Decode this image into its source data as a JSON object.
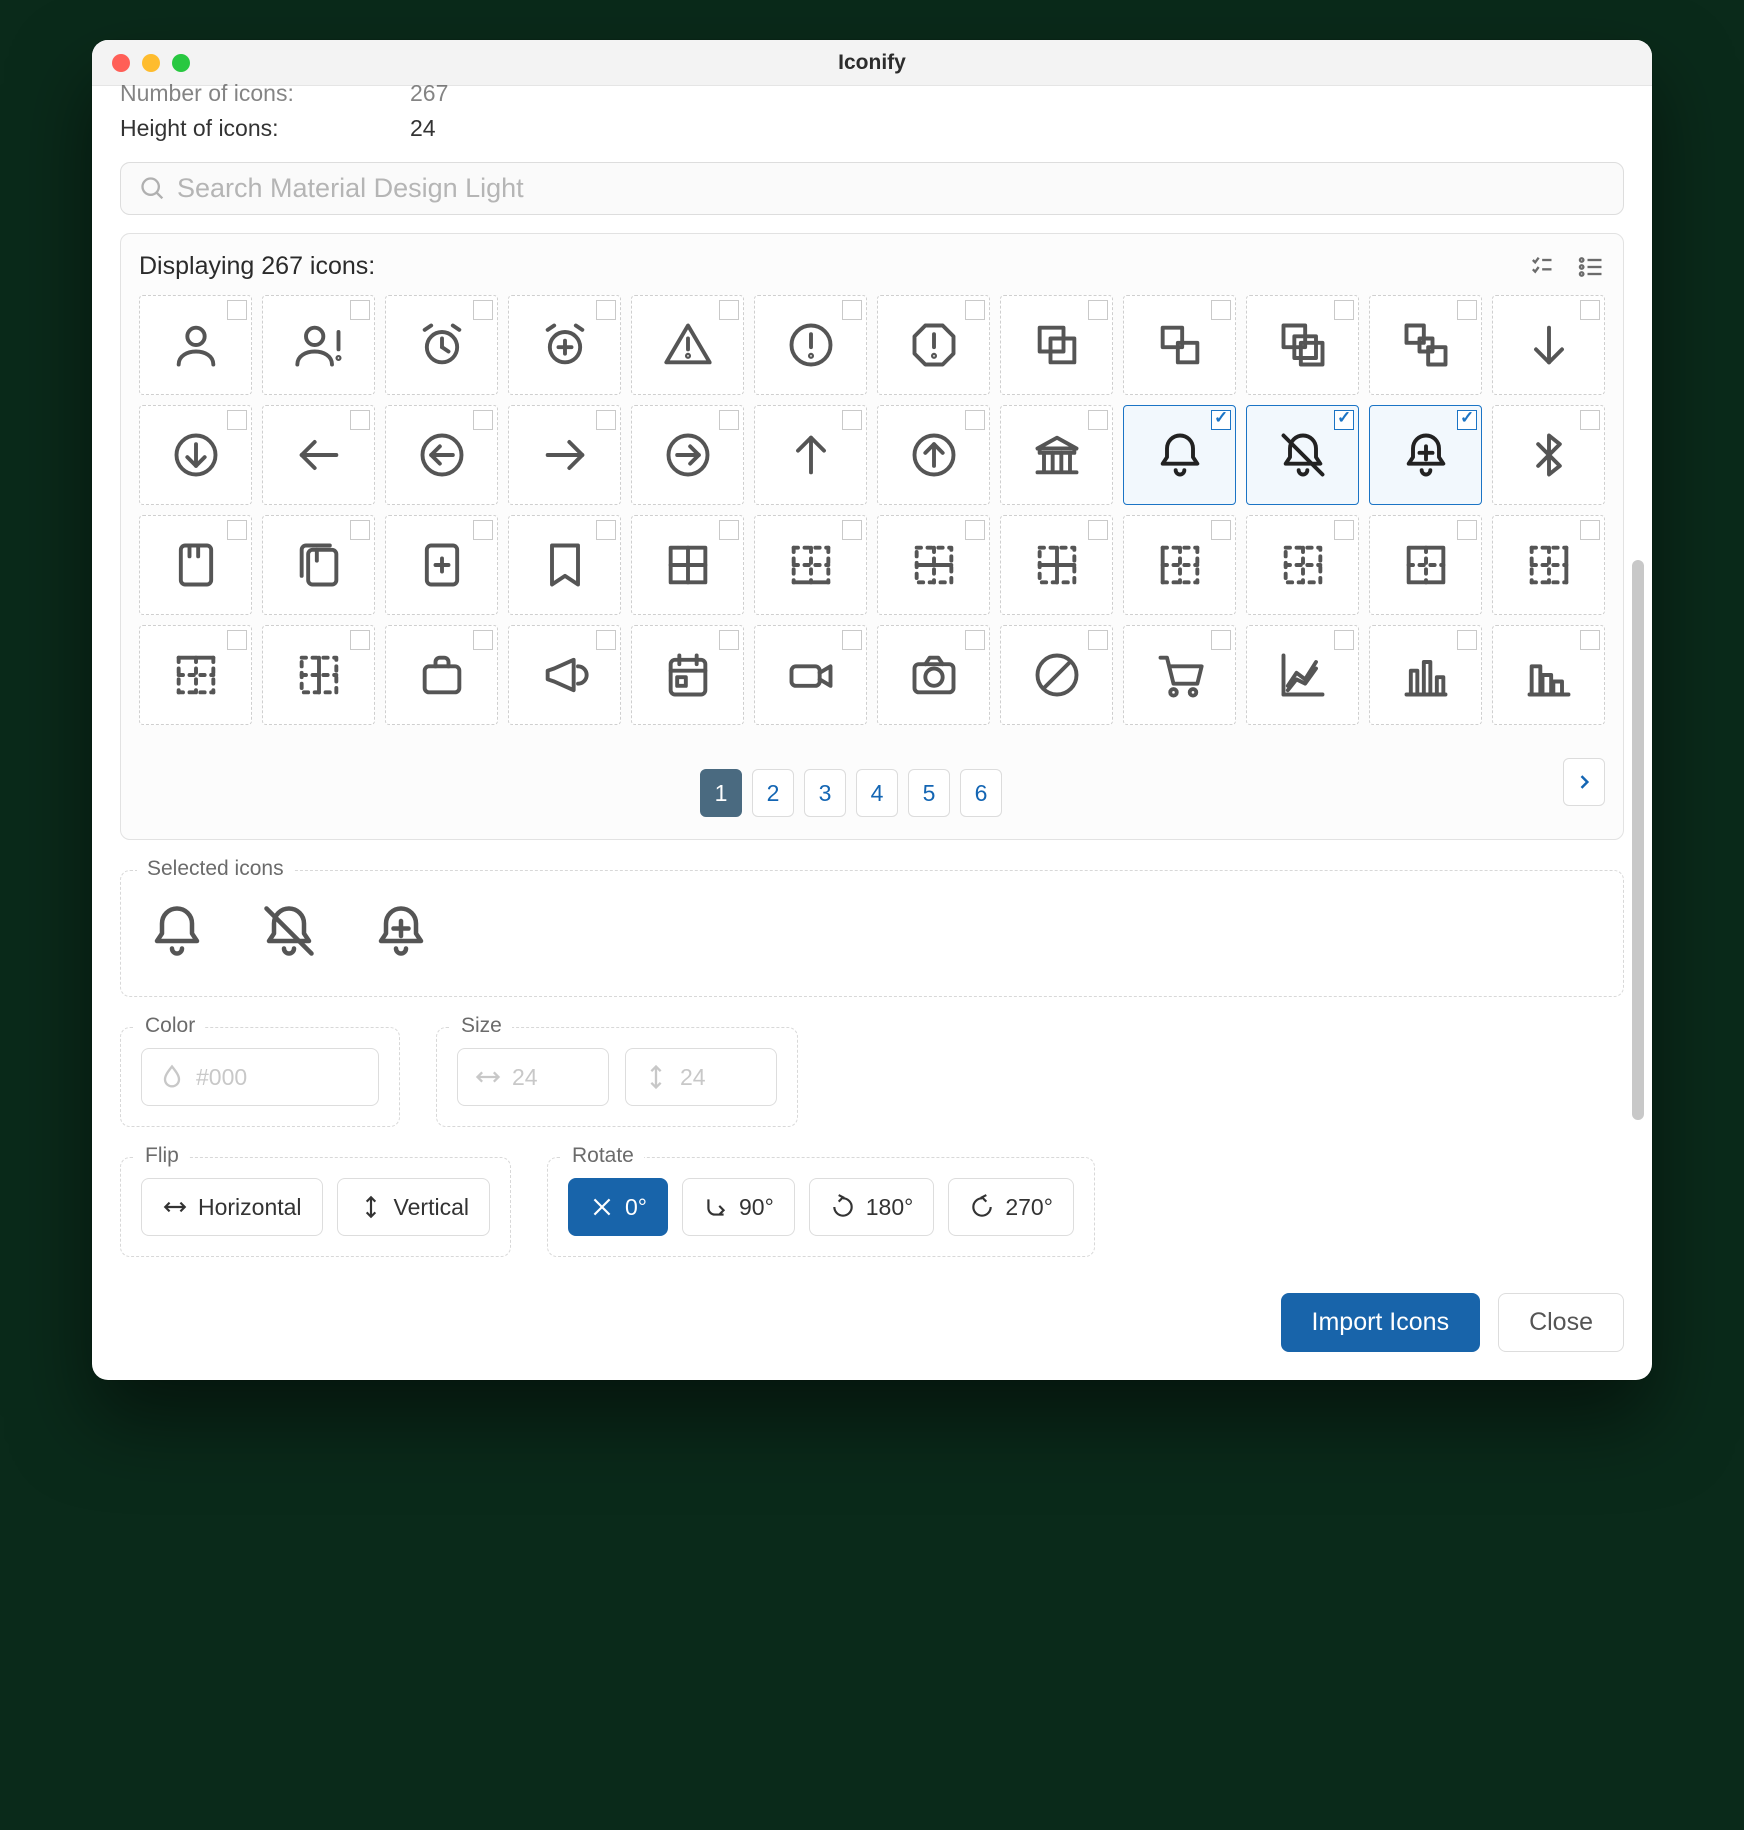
{
  "window_title": "Iconify",
  "meta": {
    "num_label": "Number of icons:",
    "num_value": "267",
    "height_label": "Height of icons:",
    "height_value": "24"
  },
  "search": {
    "placeholder": "Search Material Design Light"
  },
  "displaying": "Displaying 267 icons:",
  "pages": [
    "1",
    "2",
    "3",
    "4",
    "5",
    "6"
  ],
  "active_page": "1",
  "selected_label": "Selected icons",
  "color": {
    "label": "Color",
    "placeholder": "#000"
  },
  "size": {
    "label": "Size",
    "w_placeholder": "24",
    "h_placeholder": "24"
  },
  "flip": {
    "label": "Flip",
    "horizontal": "Horizontal",
    "vertical": "Vertical"
  },
  "rotate": {
    "label": "Rotate",
    "r0": "0°",
    "r90": "90°",
    "r180": "180°",
    "r270": "270°"
  },
  "footer": {
    "import": "Import Icons",
    "close": "Close"
  },
  "icons": [
    {
      "name": "account",
      "sel": false
    },
    {
      "name": "account-alert",
      "sel": false
    },
    {
      "name": "alarm",
      "sel": false
    },
    {
      "name": "alarm-plus",
      "sel": false
    },
    {
      "name": "alert-triangle",
      "sel": false
    },
    {
      "name": "alert-circle",
      "sel": false
    },
    {
      "name": "alert-octagon",
      "sel": false
    },
    {
      "name": "arrange-bring-forward",
      "sel": false
    },
    {
      "name": "arrange-send-backward",
      "sel": false
    },
    {
      "name": "arrange-bring-to-front",
      "sel": false
    },
    {
      "name": "arrange-send-to-back",
      "sel": false
    },
    {
      "name": "arrow-down",
      "sel": false
    },
    {
      "name": "arrow-down-circle",
      "sel": false
    },
    {
      "name": "arrow-left",
      "sel": false
    },
    {
      "name": "arrow-left-circle",
      "sel": false
    },
    {
      "name": "arrow-right",
      "sel": false
    },
    {
      "name": "arrow-right-circle",
      "sel": false
    },
    {
      "name": "arrow-up",
      "sel": false
    },
    {
      "name": "arrow-up-circle",
      "sel": false
    },
    {
      "name": "bank",
      "sel": false
    },
    {
      "name": "bell",
      "sel": true
    },
    {
      "name": "bell-off",
      "sel": true
    },
    {
      "name": "bell-plus",
      "sel": true
    },
    {
      "name": "bluetooth",
      "sel": false
    },
    {
      "name": "book",
      "sel": false
    },
    {
      "name": "book-multiple",
      "sel": false
    },
    {
      "name": "book-plus",
      "sel": false
    },
    {
      "name": "bookmark",
      "sel": false
    },
    {
      "name": "border-all",
      "sel": false
    },
    {
      "name": "border-bottom",
      "sel": false
    },
    {
      "name": "border-horizontal",
      "sel": false
    },
    {
      "name": "border-inside",
      "sel": false
    },
    {
      "name": "border-left",
      "sel": false
    },
    {
      "name": "border-none",
      "sel": false
    },
    {
      "name": "border-outside",
      "sel": false
    },
    {
      "name": "border-right",
      "sel": false
    },
    {
      "name": "border-top",
      "sel": false
    },
    {
      "name": "border-vertical",
      "sel": false
    },
    {
      "name": "briefcase",
      "sel": false
    },
    {
      "name": "bullhorn",
      "sel": false
    },
    {
      "name": "calendar",
      "sel": false
    },
    {
      "name": "camcorder",
      "sel": false
    },
    {
      "name": "camera",
      "sel": false
    },
    {
      "name": "cancel",
      "sel": false
    },
    {
      "name": "cart",
      "sel": false
    },
    {
      "name": "chart-areaspline",
      "sel": false
    },
    {
      "name": "chart-bar",
      "sel": false
    },
    {
      "name": "chart-histogram",
      "sel": false
    }
  ],
  "selected_icons": [
    "bell",
    "bell-off",
    "bell-plus"
  ]
}
